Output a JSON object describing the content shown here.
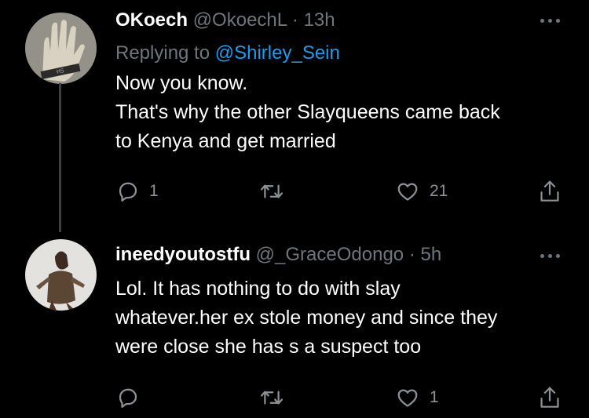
{
  "tweets": [
    {
      "name": "OKoech",
      "handle": "@OkoechL",
      "dot": "·",
      "time": "13h",
      "replying_label": "Replying to",
      "replying_to": "@Shirley_Sein",
      "lines": [
        "Now you know.",
        "That's why the other Slayqueens came back",
        "to Kenya and get married"
      ],
      "reply_count": "1",
      "retweet_count": "",
      "like_count": "21"
    },
    {
      "name": "ineedyoutostfu",
      "handle": "@_GraceOdongo",
      "dot": "·",
      "time": "5h",
      "lines": [
        "Lol. It  has nothing to do with slay",
        "whatever.her ex stole money and since they",
        "were close she has s a suspect too"
      ],
      "reply_count": "",
      "retweet_count": "",
      "like_count": "1"
    }
  ],
  "icons": {
    "reply": "reply-icon",
    "retweet": "retweet-icon",
    "like": "heart-icon",
    "share": "share-icon",
    "more": "more-icon"
  },
  "colors": {
    "background": "#000000",
    "text": "#ffffff",
    "secondary": "#6e767d",
    "link": "#1d9bf0"
  }
}
